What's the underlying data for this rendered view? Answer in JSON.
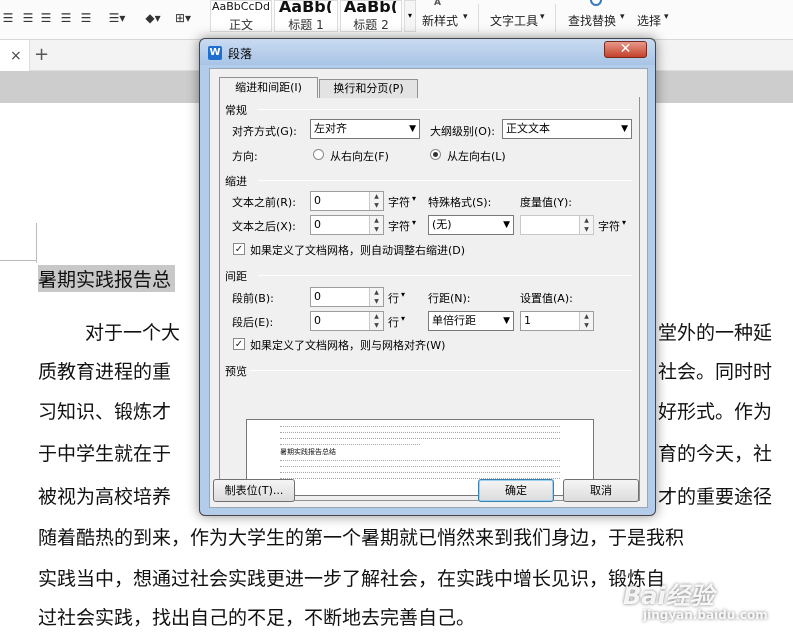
{
  "ribbon": {
    "style_previews": [
      {
        "preview": "AaBbCcDd",
        "label": "正文"
      },
      {
        "preview": "AaBb(",
        "label": "标题 1"
      },
      {
        "preview": "AaBb(",
        "label": "标题 2"
      }
    ],
    "new_style": "新样式",
    "text_tools": "文字工具",
    "find_replace": "查找替换",
    "select": "选择"
  },
  "tabstrip": {
    "close": "×",
    "add": "+"
  },
  "document": {
    "lines": [
      "暑期实践报告总",
      "对于一个大",
      "质教育进程的重",
      "习知识、锻炼才",
      "于中学生就在于",
      "被视为高校培养",
      "随着酷热的到来，作为大学生的第一个暑期就已悄然来到我们身边，于是我积",
      "实践当中，想通过社会实践更进一步了解社会，在实践中增长见识，锻炼自",
      "过社会实践，找出自己的不足，不断地去完善自己。"
    ],
    "right_fragments": [
      "堂外的一种延",
      "社会。同时时",
      "好形式。作为",
      "育的今天，社",
      "才的重要途径"
    ],
    "watermark": "Bai经验",
    "watermark_url": "jingyan.baidu.com"
  },
  "dialog": {
    "title": "段落",
    "close": "✕",
    "tabs": [
      "缩进和间距(I)",
      "换行和分页(P)"
    ],
    "general": {
      "section": "常规",
      "alignment_label": "对齐方式(G):",
      "alignment_value": "左对齐",
      "outline_label": "大纲级别(O):",
      "outline_value": "正文文本",
      "direction_label": "方向:",
      "rtl_label": "从右向左(F)",
      "ltr_label": "从左向右(L)",
      "direction_selected": "ltr"
    },
    "indent": {
      "section": "缩进",
      "before_label": "文本之前(R):",
      "before_value": "0",
      "before_unit": "字符",
      "after_label": "文本之后(X):",
      "after_value": "0",
      "after_unit": "字符",
      "special_label": "特殊格式(S):",
      "special_value": "(无)",
      "measure_label": "度量值(Y):",
      "measure_value": "",
      "measure_unit": "字符",
      "grid_checkbox": "如果定义了文档网格，则自动调整右缩进(D)",
      "grid_checked": true
    },
    "spacing": {
      "section": "间距",
      "before_label": "段前(B):",
      "before_value": "0",
      "before_unit": "行",
      "after_label": "段后(E):",
      "after_value": "0",
      "after_unit": "行",
      "line_label": "行距(N):",
      "line_value": "单倍行距",
      "setting_label": "设置值(A):",
      "setting_value": "1",
      "grid_checkbox": "如果定义了文档网格，则与网格对齐(W)",
      "grid_checked": true
    },
    "preview": {
      "section": "预览",
      "sample_text": "暑期实践报告总结",
      "filler_text": "前一段落前一段落前一段落前一段落前一段落前一段落"
    },
    "buttons": {
      "tabs": "制表位(T)...",
      "ok": "确定",
      "cancel": "取消"
    }
  }
}
